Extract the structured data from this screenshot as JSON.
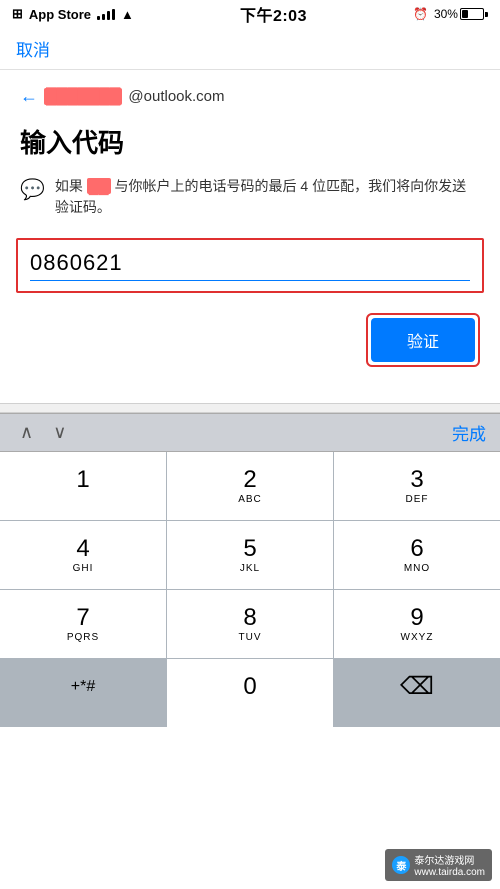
{
  "statusBar": {
    "appStore": "App Store",
    "time": "下午2:03",
    "batteryPercent": "30%"
  },
  "nav": {
    "cancelLabel": "取消"
  },
  "content": {
    "emailPrefix": "",
    "emailDomain": "@outlook.com",
    "pageTitle": "输入代码",
    "infoText1": "如果",
    "infoTextRedacted": "████",
    "infoText2": "与你帐户上的电话号码的最后 4 位匹配，我们将向你发送验证码。",
    "codeValue": "0860621",
    "verifyLabel": "验证"
  },
  "keyboard": {
    "doneLabel": "完成",
    "keys": [
      {
        "main": "1",
        "sub": ""
      },
      {
        "main": "2",
        "sub": "ABC"
      },
      {
        "main": "3",
        "sub": "DEF"
      },
      {
        "main": "4",
        "sub": "GHI"
      },
      {
        "main": "5",
        "sub": "JKL"
      },
      {
        "main": "6",
        "sub": "MNO"
      },
      {
        "main": "7",
        "sub": "PQRS"
      },
      {
        "main": "8",
        "sub": "TUV"
      },
      {
        "main": "9",
        "sub": "WXYZ"
      },
      {
        "main": "+*#",
        "sub": ""
      },
      {
        "main": "0",
        "sub": ""
      },
      {
        "main": "⌫",
        "sub": ""
      }
    ]
  },
  "watermark": {
    "text": "泰尔达游戏网",
    "url": "www.tairda.com"
  }
}
